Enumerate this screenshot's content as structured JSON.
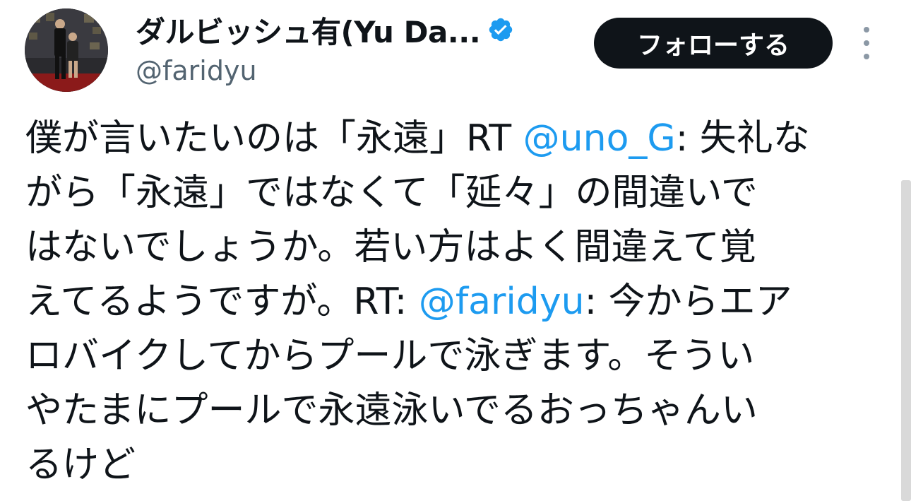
{
  "author": {
    "display_name": "ダルビッシュ有(Yu Da...",
    "handle": "@faridyu",
    "verified_icon": "verified-badge-icon"
  },
  "actions": {
    "follow_label": "フォローする",
    "more_icon": "more-vertical-icon"
  },
  "tweet": {
    "lines": [
      {
        "parts": [
          {
            "text": "僕が言いたいのは「永遠」RT "
          },
          {
            "text": "@uno_G",
            "mention": true
          },
          {
            "text": ": 失礼な"
          }
        ]
      },
      {
        "parts": [
          {
            "text": "がら「永遠」ではなくて「延々」の間違いで"
          }
        ]
      },
      {
        "parts": [
          {
            "text": "はないでしょうか。若い方はよく間違えて覚"
          }
        ]
      },
      {
        "parts": [
          {
            "text": "えてるようですが。RT: "
          },
          {
            "text": "@faridyu",
            "mention": true
          },
          {
            "text": ": 今からエア"
          }
        ]
      },
      {
        "parts": [
          {
            "text": "ロバイクしてからプールで泳ぎます。そうい"
          }
        ]
      },
      {
        "parts": [
          {
            "text": "やたまにプールで永遠泳いでるおっちゃんい"
          }
        ]
      },
      {
        "parts": [
          {
            "text": "るけど"
          }
        ]
      }
    ]
  },
  "colors": {
    "text": "#0f1419",
    "secondary_text": "#536471",
    "mention": "#1d9bf0",
    "verified": "#1d9bf0",
    "follow_button_bg": "#0f1419"
  }
}
